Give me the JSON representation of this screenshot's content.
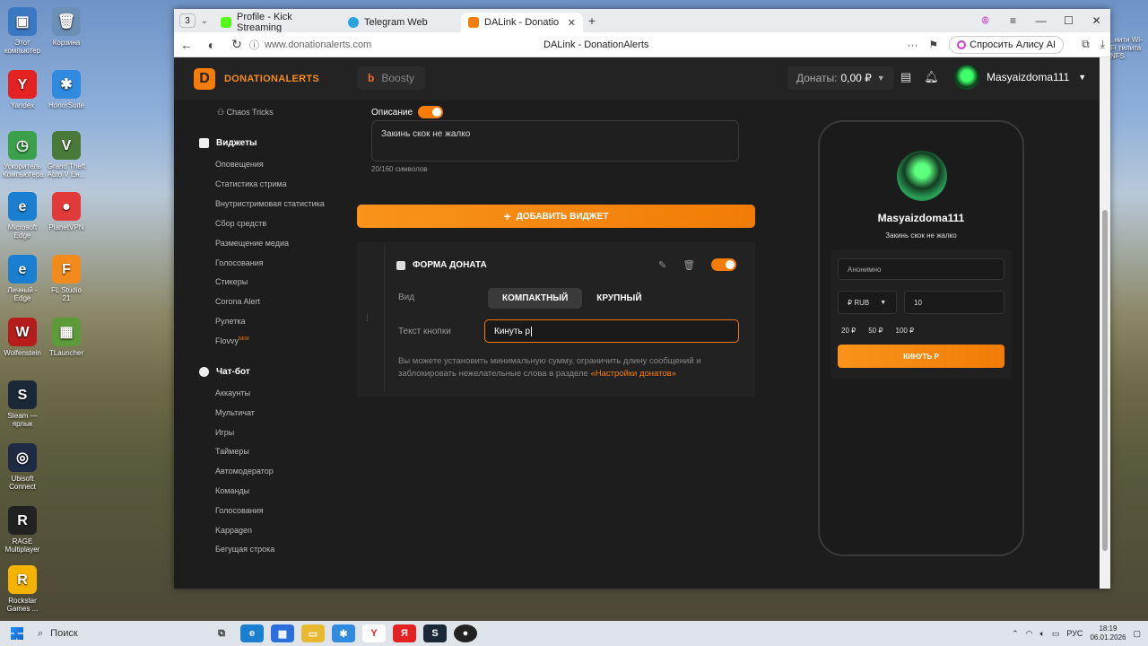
{
  "desktop": {
    "left_icons": [
      {
        "label": "Этот компьютер",
        "color": "#3b78c4",
        "glyph": "▣"
      },
      {
        "label": "Корзина",
        "color": "#6b8fb5",
        "glyph": "🗑"
      },
      {
        "label": "Yandex",
        "color": "#e52222",
        "glyph": "Y"
      },
      {
        "label": "HonorSuite",
        "color": "#2f8ae0",
        "glyph": "✱"
      },
      {
        "label": "Ускоритель Компьютера",
        "color": "#3aa04a",
        "glyph": "◷"
      },
      {
        "label": "Grand Theft Auto V Ен...",
        "color": "#4a7a3a",
        "glyph": "V"
      },
      {
        "label": "Microsoft Edge",
        "color": "#1a7fd1",
        "glyph": "e"
      },
      {
        "label": "PlanetVPN",
        "color": "#e23a3a",
        "glyph": "●"
      },
      {
        "label": "Личный - Edge",
        "color": "#1a7fd1",
        "glyph": "e"
      },
      {
        "label": "FL Studio 21",
        "color": "#f38b1c",
        "glyph": "F"
      },
      {
        "label": "Wolfenstein",
        "color": "#b71c1c",
        "glyph": "W"
      },
      {
        "label": "TLauncher",
        "color": "#5d9b3a",
        "glyph": "▦"
      },
      {
        "label": "Steam — ярлык",
        "color": "#1b2838",
        "glyph": "S"
      },
      {
        "label": "Ubisoft Connect",
        "color": "#1f2a44",
        "glyph": "◎"
      },
      {
        "label": "RAGE Multiplayer",
        "color": "#222",
        "glyph": "R"
      },
      {
        "label": "Rockstar Games ...",
        "color": "#f5b301",
        "glyph": "R"
      }
    ],
    "right_text": "..нити Wi-Fi тилита NFS"
  },
  "browser": {
    "tab_count": "3",
    "tabs": [
      {
        "title": "Profile - Kick Streaming",
        "color": "#53fc18"
      },
      {
        "title": "Telegram Web",
        "color": "#2aa3df"
      },
      {
        "title": "DALink - DonationAlerts",
        "color": "#f57d07"
      }
    ],
    "new_tab": "+",
    "url": "www.donationalerts.com",
    "page_title": "DALink - DonationAlerts",
    "alice": "Спросить Алису AI"
  },
  "site": {
    "logo": "DONATIONALERTS",
    "boosty": "Boosty",
    "donats_label": "Донаты:",
    "donats_value": "0,00 ₽",
    "username": "Masyaizdoma111",
    "sidebar": {
      "top_item": "Chaos Tricks",
      "widgets_header": "Виджеты",
      "widgets": [
        "Оповещения",
        "Статистика стрима",
        "Внутристримовая статистика",
        "Сбор средств",
        "Размещение медиа",
        "Голосования",
        "Стикеры",
        "Corona Alert",
        "Рулетка",
        "Flovvy"
      ],
      "new_badge": "NEW",
      "chat_header": "Чат-бот",
      "chat": [
        "Аккаунты",
        "Мультичат",
        "Игры",
        "Таймеры",
        "Автомодератор",
        "Команды",
        "Голосования",
        "Kappagen",
        "Бегущая строка"
      ]
    },
    "main": {
      "desc_label": "Описание",
      "desc_text": "Закинь скок не жалко",
      "counter": "20/160 символов",
      "add_widget": "ДОБАВИТЬ ВИДЖЕТ",
      "form_title": "ФОРМА ДОНАТА",
      "view_label": "Вид",
      "compact": "КОМПАКТНЫЙ",
      "large": "КРУПНЫЙ",
      "btn_text_label": "Текст кнопки",
      "btn_text_value": "Кинуть р",
      "hint": "Вы можете установить минимальную сумму, ограничить длину сообщений и заблокировать нежелательные слова в разделе",
      "hint_link": "«Настройки донатов»"
    },
    "preview": {
      "name": "Masyaizdoma111",
      "desc": "Закинь скок не жалко",
      "anon": "Анонимно",
      "currency": "₽ RUB",
      "amount": "10",
      "chips": [
        "20 ₽",
        "50 ₽",
        "100 ₽"
      ],
      "button": "КИНУТЬ Р"
    }
  },
  "taskbar": {
    "search": "Поиск",
    "lang": "РУС",
    "time": "18:19",
    "date": "06.01.2026"
  }
}
